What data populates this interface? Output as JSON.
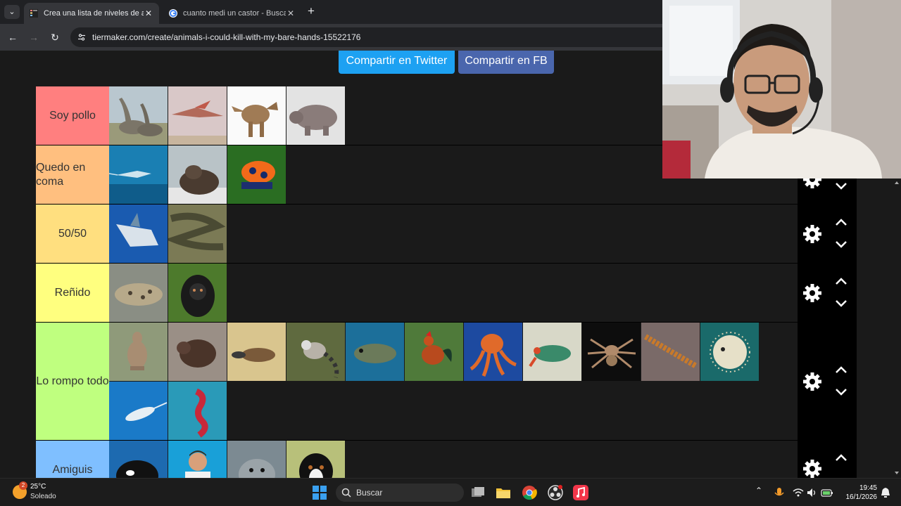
{
  "browser": {
    "tabs": [
      {
        "title": "Crea una lista de niveles de ani",
        "close": "✕"
      },
      {
        "title": "cuanto medi un castor - Buscar",
        "close": "✕"
      }
    ],
    "new_tab": "+",
    "tab_dropdown": "⌄",
    "nav": {
      "back": "←",
      "forward": "→",
      "reload": "↻"
    },
    "url": "tiermaker.com/create/animals-i-could-kill-with-my-bare-hands-15522176"
  },
  "page": {
    "share_twitter": "Compartir en Twitter",
    "share_fb": "Compartir en FB",
    "tiers": [
      {
        "label": "Soy pollo",
        "color": "#ff7f7f",
        "items": [
          "brachiosaurus",
          "pterodactyl",
          "dinosaur",
          "hippo"
        ]
      },
      {
        "label": "Quedo en coma",
        "color": "#ffbf7f",
        "items": [
          "swordfish",
          "walrus",
          "poison-dart-frog"
        ]
      },
      {
        "label": "50/50",
        "color": "#ffdf7f",
        "items": [
          "shark",
          "anaconda"
        ]
      },
      {
        "label": "Reñido",
        "color": "#ffff7f",
        "items": [
          "leopard-shark",
          "macaque"
        ]
      },
      {
        "label": "Lo rompo todo",
        "color": "#bfff7f",
        "items": [
          "kangaroo",
          "beaver",
          "platypus",
          "lemur",
          "grouper",
          "rooster",
          "octopus",
          "mantis-shrimp",
          "tarantula",
          "centipede",
          "pufferfish",
          "narwhal",
          "seahorse"
        ]
      },
      {
        "label": "Amiguis",
        "color": "#7fbfff",
        "items": [
          "orca",
          "man",
          "seal",
          "dog"
        ]
      }
    ]
  },
  "taskbar": {
    "weather_temp": "25°C",
    "weather_cond": "Soleado",
    "weather_badge": "2",
    "search_label": "Buscar",
    "time": "19:45",
    "date": "16/1/2026"
  }
}
